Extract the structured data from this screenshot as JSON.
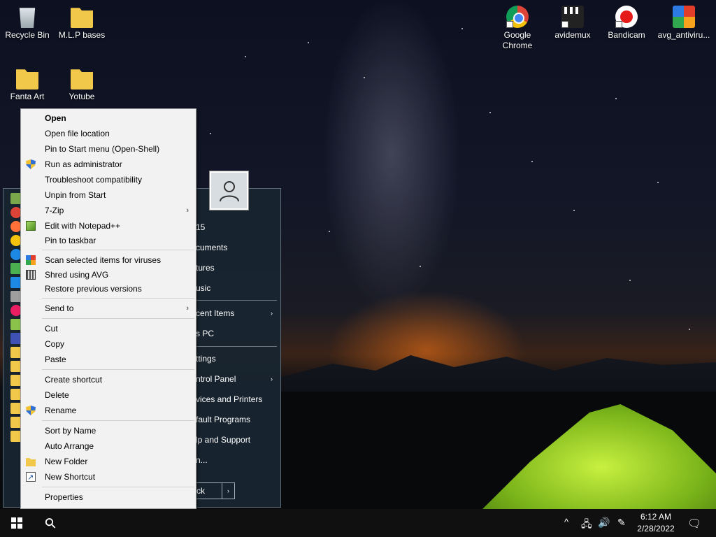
{
  "desktop": {
    "icons": [
      {
        "label": "Recycle Bin",
        "icon": "recycle-bin-icon"
      },
      {
        "label": "M.L.P bases",
        "icon": "folder-icon"
      },
      {
        "label": "Fanta Art",
        "icon": "folder-icon"
      },
      {
        "label": "Yotube",
        "icon": "folder-icon"
      },
      {
        "label": "Google Chrome",
        "icon": "chrome-icon"
      },
      {
        "label": "avidemux",
        "icon": "avidemux-icon"
      },
      {
        "label": "Bandicam",
        "icon": "bandicam-icon"
      },
      {
        "label": "avg_antiviru...",
        "icon": "avg-icon"
      }
    ]
  },
  "start_menu": {
    "items": [
      {
        "label": "15"
      },
      {
        "label": "cuments"
      },
      {
        "label": "tures"
      },
      {
        "label": "usic"
      },
      {
        "label": "cent Items",
        "submenu": "›"
      },
      {
        "label": "s PC"
      },
      {
        "label": "ttings"
      },
      {
        "label": "ntrol Panel",
        "submenu": "›"
      },
      {
        "label": "vices and Printers"
      },
      {
        "label": "fault Programs"
      },
      {
        "label": "lp and Support"
      },
      {
        "label": "n..."
      }
    ],
    "shutdown_label": "ck",
    "shutdown_arrow": "›"
  },
  "context_menu": {
    "items": [
      {
        "label": "Open"
      },
      {
        "label": "Open file location"
      },
      {
        "label": "Pin to Start menu (Open-Shell)"
      },
      {
        "label": "Run as administrator",
        "icon": "uac-shield-icon"
      },
      {
        "label": "Troubleshoot compatibility"
      },
      {
        "label": "Unpin from Start"
      },
      {
        "label": "7-Zip",
        "submenu": "›"
      },
      {
        "label": "Edit with Notepad++",
        "icon": "notepad-plus-plus-icon"
      },
      {
        "label": "Pin to taskbar"
      },
      {
        "label": "Scan selected items for viruses",
        "icon": "avg-scan-icon"
      },
      {
        "label": "Shred using AVG",
        "icon": "shredder-icon"
      },
      {
        "label": "Restore previous versions"
      },
      {
        "label": "Send to",
        "submenu": "›"
      },
      {
        "label": "Cut"
      },
      {
        "label": "Copy"
      },
      {
        "label": "Paste"
      },
      {
        "label": "Create shortcut"
      },
      {
        "label": "Delete"
      },
      {
        "label": "Rename",
        "icon": "uac-shield-icon"
      },
      {
        "label": "Sort by Name"
      },
      {
        "label": "Auto Arrange"
      },
      {
        "label": "New Folder",
        "icon": "new-folder-icon"
      },
      {
        "label": "New Shortcut",
        "icon": "new-shortcut-icon"
      },
      {
        "label": "Properties"
      }
    ]
  },
  "taskbar": {
    "time": "6:12 AM",
    "date": "2/28/2022",
    "tray_icons": [
      "chevron-up-icon",
      "network-icon",
      "volume-icon",
      "pen-icon",
      "notification-icon"
    ],
    "glyphs": {
      "chevron": "^",
      "network": "🖧",
      "volume": "🔊",
      "pen": "✎",
      "notification": "🗨",
      "search": "⚲"
    }
  }
}
